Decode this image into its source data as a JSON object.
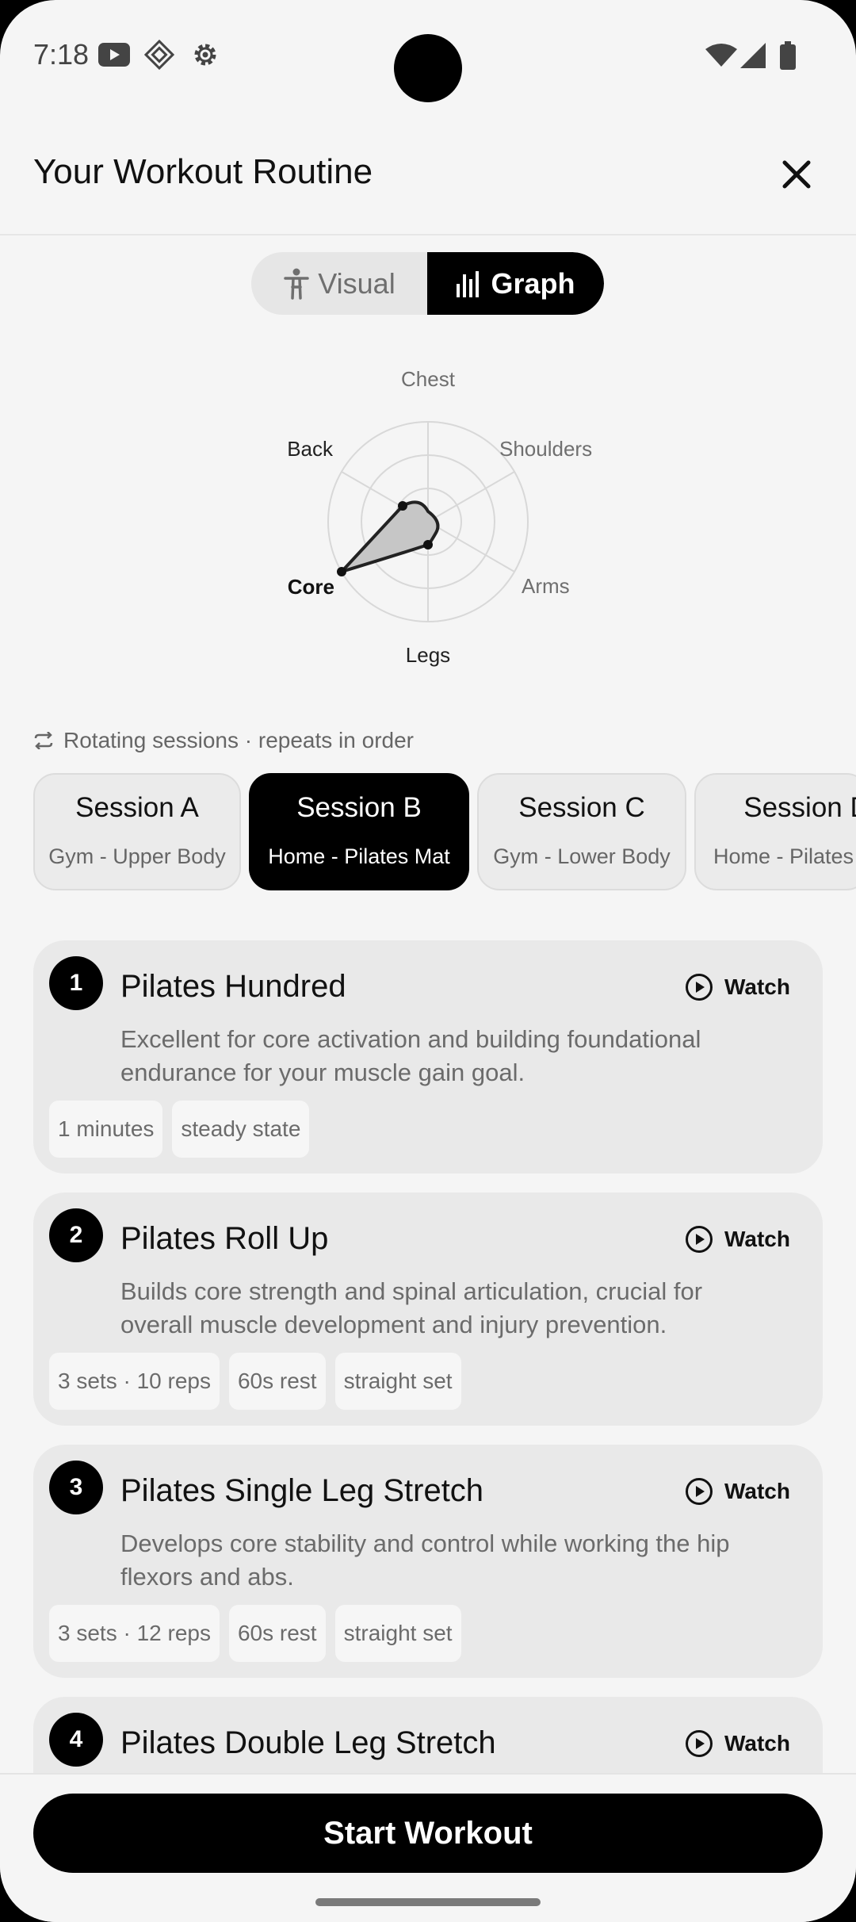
{
  "status": {
    "time": "7:18"
  },
  "header": {
    "title": "Your Workout Routine"
  },
  "toggle": {
    "visual_label": "Visual",
    "graph_label": "Graph",
    "selected": "Graph"
  },
  "chart_data": {
    "type": "radar",
    "axes": [
      "Chest",
      "Shoulders",
      "Arms",
      "Legs",
      "Core",
      "Back"
    ],
    "emphasized_axis": "Core"
  },
  "sessions_note": "Rotating sessions · repeats in order",
  "sessions": [
    {
      "name": "Session A",
      "desc": "Gym - Upper Body"
    },
    {
      "name": "Session B",
      "desc": "Home - Pilates Mat"
    },
    {
      "name": "Session C",
      "desc": "Gym - Lower Body"
    },
    {
      "name": "Session D",
      "desc": "Home - Pilates"
    }
  ],
  "selected_session": "Session B",
  "watch_label": "Watch",
  "exercises": [
    {
      "num": "1",
      "name": "Pilates Hundred",
      "desc": "Excellent for core activation and building foundational endurance for your muscle gain goal.",
      "tags": [
        "1 minutes",
        "steady state"
      ]
    },
    {
      "num": "2",
      "name": "Pilates Roll Up",
      "desc": "Builds core strength and spinal articulation, crucial for overall muscle development and injury prevention.",
      "tags": [
        "3 sets · 10 reps",
        "60s rest",
        "straight set"
      ]
    },
    {
      "num": "3",
      "name": "Pilates Single Leg Stretch",
      "desc": "Develops core stability and control while working the hip flexors and abs.",
      "tags": [
        "3 sets · 12 reps",
        "60s rest",
        "straight set"
      ]
    },
    {
      "num": "4",
      "name": "Pilates Double Leg Stretch"
    }
  ],
  "start_button": "Start Workout"
}
